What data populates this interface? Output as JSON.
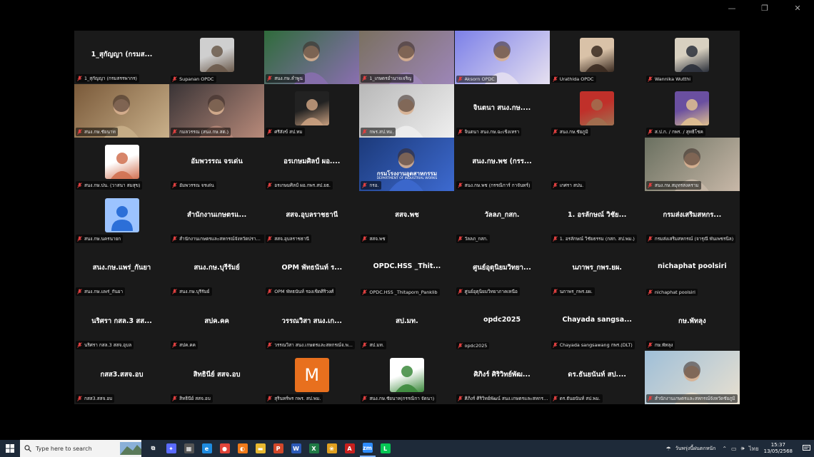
{
  "window": {
    "controls": [
      "—",
      "❐",
      "✕"
    ]
  },
  "tiles": [
    {
      "name": "1_สุกัญญา (กรมสรรพากร)",
      "big": "1_สุกัญญา (กรมส...",
      "kind": "text"
    },
    {
      "name": "Supanan OPDC",
      "kind": "photo",
      "c1": "#cfcfcf",
      "c2": "#6b5a4b"
    },
    {
      "name": "สนง.กษ.ลำพูน",
      "kind": "video",
      "c1": "#2f6b3b",
      "c2": "#8a6fb0"
    },
    {
      "name": "1_เกษตรอำนาจเจริญ",
      "kind": "video",
      "c1": "#7a7060",
      "c2": "#9d86b8"
    },
    {
      "name": "Aksorn OPDC",
      "kind": "video",
      "c1": "#7c80e8",
      "c2": "#e6e0f0",
      "speaking": true
    },
    {
      "name": "Urathida OPDC",
      "kind": "photo",
      "c1": "#d9c2a8",
      "c2": "#3a2a20"
    },
    {
      "name": "Wannika Wutthi",
      "kind": "photo",
      "c1": "#d8d0c0",
      "c2": "#2a2f3a"
    },
    {
      "name": "สนง.กษ.ชัยนาท",
      "kind": "video",
      "c1": "#7a5a3a",
      "c2": "#c9b08a"
    },
    {
      "name": "กมลวรรณ (สนง.กษ.สต.)",
      "kind": "video",
      "c1": "#3a3436",
      "c2": "#b88a7a"
    },
    {
      "name": "ศรีสังข์ สป.ทม",
      "kind": "photo",
      "c1": "#222",
      "c2": "#c9a080"
    },
    {
      "name": "กพร.สป.ทม.",
      "kind": "video",
      "c1": "#b8b8b8",
      "c2": "#efefef"
    },
    {
      "name": "จินตนา สนง.กษ.ฉะเชิงเทรา",
      "big": "จินตนา สนง.กษ....",
      "kind": "text"
    },
    {
      "name": "สนง.กษ.ชัยภูมิ",
      "kind": "photo",
      "c1": "#c0302a",
      "c2": "#a07050"
    },
    {
      "name": "ส.ป.ก. / กพร. / สุทธิโชค",
      "kind": "photo",
      "c1": "#6a4fa0",
      "c2": "#e0c090"
    },
    {
      "name": "สนง.กษ.ปน. (วาสนา สมสุข)",
      "kind": "photo",
      "c1": "#ffffff",
      "c2": "#d07050"
    },
    {
      "name": "อัมพวรรณ  จรเด่น",
      "big": "อัมพวรรณ  จรเด่น",
      "kind": "text"
    },
    {
      "name": "อรเกษมศิลป์ ผอ.กพร.สป.ยธ.",
      "big": "อรเกษมศิลป์ ผอ....",
      "kind": "text"
    },
    {
      "name": "กรอ.",
      "kind": "video",
      "c1": "#1c3a7a",
      "c2": "#3d6ad0",
      "caption": "กรมโรงงานอุตสาหกรรม",
      "caption2": "DEPARTMENT OF INDUSTRIAL WORKS"
    },
    {
      "name": "สนง.กษ.พช (กรรณิการ์ กาจันทร์)",
      "big": "สนง.กษ.พช (กรร...",
      "kind": "text"
    },
    {
      "name": "เกศรา สปน.",
      "kind": "blank"
    },
    {
      "name": "สนง.กษ.สมุทรสงคราม",
      "kind": "video",
      "c1": "#6a7060",
      "c2": "#c8b8a8"
    },
    {
      "name": "สนง.กษ.นครนายก",
      "kind": "avatar"
    },
    {
      "name": "สำนักงานเกษตรและสหกรณ์จังหวัดปราจีนบุรี",
      "big": "สำนักงานเกษตรแ...",
      "kind": "text"
    },
    {
      "name": "สสจ.อุบลราชธานี",
      "big": "สสจ.อุบลราชธานี",
      "kind": "text"
    },
    {
      "name": "สสจ.พช",
      "big": "สสจ.พช",
      "kind": "text"
    },
    {
      "name": "วัลลภ_กสก.",
      "big": "วัลลภ_กสก.",
      "kind": "text"
    },
    {
      "name": "1. อรลักษณ์  วิชัยธรรม (กสก. สป.พม.)",
      "big": "1. อรลักษณ์  วิชัย...",
      "kind": "text"
    },
    {
      "name": "กรมส่งเสริมสหกรณ์ (จารุณี พันเพชรนิล)",
      "big": "กรมส่งเสริมสหกร...",
      "kind": "text"
    },
    {
      "name": "สนง.กษ.แพร่_กันยา",
      "big": "สนง.กษ.แพร่_กันยา",
      "kind": "text"
    },
    {
      "name": "สนง.กษ.บุรีรัมย์",
      "big": "สนง.กษ.บุรีรัมย์",
      "kind": "text"
    },
    {
      "name": "OPM พัทธนันท์ รองเชิดศิริวงศ์",
      "big": "OPM พัทธนันท์ ร...",
      "kind": "text"
    },
    {
      "name": "OPDC.HSS _Thitaporn_Panklib",
      "big": "OPDC.HSS _Thit...",
      "kind": "text"
    },
    {
      "name": "ศูนย์อุตุนิยมวิทยาภาคเหนือ",
      "big": "ศูนย์อุตุนิยมวิทยา...",
      "kind": "text"
    },
    {
      "name": "นภาพร_กพร.ยผ.",
      "big": "นภาพร_กพร.ยผ.",
      "kind": "text"
    },
    {
      "name": "nichaphat poolsiri",
      "big": "nichaphat poolsiri",
      "kind": "text"
    },
    {
      "name": "นริศรา กสล.3 สสจ.อุบล",
      "big": "นริศรา  กสล.3 สส...",
      "kind": "text"
    },
    {
      "name": "สปค.คค",
      "big": "สปค.คค",
      "kind": "text"
    },
    {
      "name": "วรรณวิสา สนง.เกษตรและสหกรณ์จ.พ...",
      "big": "วรรณวิสา สนง.เก...",
      "kind": "text"
    },
    {
      "name": "สป.มท.",
      "big": "สป.มท.",
      "kind": "text"
    },
    {
      "name": "opdc2025",
      "big": "opdc2025",
      "kind": "text"
    },
    {
      "name": "Chayada sangsawang กพร.(DLT)",
      "big": "Chayada  sangsa...",
      "kind": "text"
    },
    {
      "name": "กษ.พัทลุง",
      "big": "กษ.พัทลุง",
      "kind": "text"
    },
    {
      "name": "กสส3.สสจ.อบ",
      "big": "กสส3.สสจ.อบ",
      "kind": "text"
    },
    {
      "name": "สิทธินีย์ สสจ.อบ",
      "big": "สิทธินีย์ สสจ.อบ",
      "kind": "text"
    },
    {
      "name": "สุรินทร์พร กพร. สป.พม.",
      "kind": "letter",
      "letter": "M",
      "c1": "#e8701e"
    },
    {
      "name": "สนง.กษ.ชัยนาท(กรรณิกา จัดนา)",
      "kind": "photo",
      "c1": "#ffffff",
      "c2": "#3c8a3c"
    },
    {
      "name": "ศิภิงร์ ศิริวิทย์พัฒน์ สนง.เกษตรและสหกรณ์...",
      "big": "ศิภิงร์ ศิริวิทย์พัฒ...",
      "kind": "text"
    },
    {
      "name": "ดร.ธันยนันท์ สป.พม.",
      "big": "ดร.ธันยนันท์  สป....",
      "kind": "text"
    },
    {
      "name": "สำนักงานเกษตรและสหกรณ์จังหวัดชัยภูมิ",
      "kind": "video",
      "c1": "#9fbfd8",
      "c2": "#e8e0d0"
    }
  ],
  "taskbar": {
    "search_placeholder": "Type here to search",
    "apps": [
      {
        "name": "task-view",
        "label": "⧉",
        "color": "#1e2a39",
        "active": false
      },
      {
        "name": "copilot",
        "label": "✦",
        "color": "#5a6bff",
        "active": false
      },
      {
        "name": "calculator",
        "label": "▦",
        "color": "#555",
        "active": false
      },
      {
        "name": "edge",
        "label": "e",
        "color": "#1e8be0",
        "active": false
      },
      {
        "name": "chrome",
        "label": "●",
        "color": "#e0453a",
        "active": false
      },
      {
        "name": "firefox",
        "label": "◐",
        "color": "#f07a1a",
        "active": false
      },
      {
        "name": "file-explorer",
        "label": "▬",
        "color": "#e8b830",
        "active": false
      },
      {
        "name": "powerpoint",
        "label": "P",
        "color": "#d2472a",
        "active": false
      },
      {
        "name": "word",
        "label": "W",
        "color": "#2b5ab8",
        "active": false
      },
      {
        "name": "excel",
        "label": "X",
        "color": "#1f7a45",
        "active": false
      },
      {
        "name": "photos",
        "label": "❀",
        "color": "#e0a020",
        "active": false
      },
      {
        "name": "acrobat",
        "label": "A",
        "color": "#c8201e",
        "active": false
      },
      {
        "name": "zoom",
        "label": "zm",
        "color": "#2d8cff",
        "active": true
      },
      {
        "name": "line",
        "label": "L",
        "color": "#06c755",
        "active": false
      }
    ],
    "weather": "วันพรุ่งนี้ฝนตกหนัก",
    "language": "ไทย",
    "time": "15:37",
    "date": "13/05/2568"
  }
}
